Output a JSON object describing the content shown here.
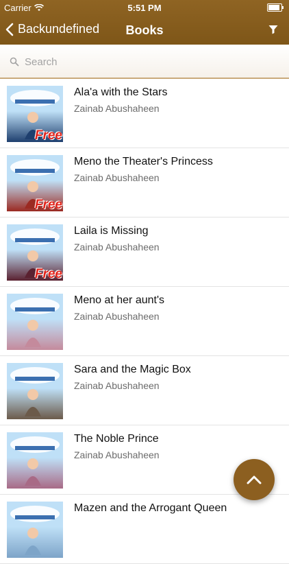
{
  "status": {
    "carrier": "Carrier",
    "time": "5:51 PM",
    "battery_level": 0.9
  },
  "nav": {
    "back_label": "Backundefined",
    "title": "Books",
    "filter_icon": "filter-icon"
  },
  "search": {
    "placeholder": "Search",
    "value": ""
  },
  "books": [
    {
      "title": "Ala'a with the Stars",
      "author": "Zainab Abushaheen",
      "cover_badge": "Free",
      "cover_color": "#1e3f6e"
    },
    {
      "title": "Meno the Theater's Princess",
      "author": "Zainab Abushaheen",
      "cover_badge": "Free",
      "cover_color": "#9b2a22"
    },
    {
      "title": "Laila is Missing",
      "author": "Zainab Abushaheen",
      "cover_badge": "Free",
      "cover_color": "#5a2130"
    },
    {
      "title": "Meno at her aunt's",
      "author": "Zainab Abushaheen",
      "cover_badge": "",
      "cover_color": "#c48a9c"
    },
    {
      "title": "Sara and the Magic Box",
      "author": "Zainab Abushaheen",
      "cover_badge": "",
      "cover_color": "#6b5a4a"
    },
    {
      "title": "The Noble Prince",
      "author": "Zainab Abushaheen",
      "cover_badge": "",
      "cover_color": "#a86a86"
    },
    {
      "title": "Mazen and the Arrogant Queen",
      "author": "",
      "cover_badge": "",
      "cover_color": "#7da4c8"
    }
  ],
  "fab": {
    "icon": "chevron-up-icon"
  },
  "colors": {
    "brand": "#8c5f20",
    "free_badge": "#e2231a"
  }
}
